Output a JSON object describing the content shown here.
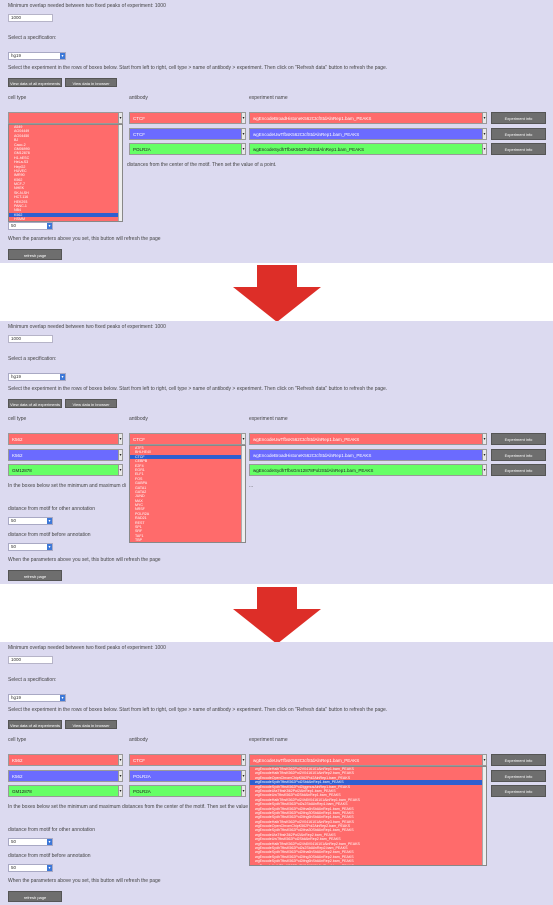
{
  "header_text": "Minimum overlap needed between two fixed peaks of experiment: 1000",
  "overlap_value": "1000",
  "genome_label": "Select a specification:",
  "genome_value": "hg19",
  "instructions": "Select the experiment in the rows of boxes below. Start from left to right, cell type > name of antibody > experiment. Then click on \"Refresh data\" button to refresh the page.",
  "buttons": {
    "view_all": "View data of all experiments",
    "view_table": "View data in browser",
    "experiment_btn": "Experiment info",
    "refresh": "refresh page"
  },
  "col_labels": {
    "cell": "cell type",
    "antibody": "antibody",
    "experiment": "experiment name"
  },
  "note_text": "In the boxes below set the minimum and maximum distances from the center of the motif. Then set the value of a point.",
  "note_text_short": "distances from the center of the motif. Then set the value of a point.",
  "min_label": "distance from motif for other annotation",
  "max_label": "distance from motif before annotation",
  "min_value": "50",
  "max_value": "50",
  "step_value": "50",
  "bottom_text": "When the parameters above you set, this button will refresh the page",
  "colors": {
    "panel_bg": "#dcdaf0",
    "row1": "#ff6b6b",
    "row2": "#6b6bff",
    "row3": "#66ff66",
    "arrow": "#dd2e28",
    "highlight": "#2f5fd0"
  },
  "panel1": {
    "rows": [
      {
        "cell": "",
        "antibody": "CTCF",
        "experiment": "wgEncodeBroadHistoneK562CtcfStdAlnRep1.bam_PEAKS"
      },
      {
        "cell": "",
        "antibody": "CTCF",
        "experiment": "wgEncodeUwTfbsK562CtcfStdAlnRep1.bam_PEAKS"
      },
      {
        "cell": "",
        "antibody": "POLR2A",
        "experiment": "wgEncodeSydhTfbsK562Pol2StdAlnRep1.bam_PEAKS"
      }
    ],
    "cell_list": [
      "A549",
      "AG04449",
      "AG04450",
      "BJ",
      "Caco-2",
      "GM06990",
      "GM12878",
      "H1-hESC",
      "HeLa-S3",
      "HepG2",
      "HUVEC",
      "IMR90",
      "K562",
      "MCF-7",
      "NHEK",
      "SK-N-SH",
      "HCT-116",
      "HEK293",
      "PANC-1",
      "NB4",
      "K562",
      "HSMM",
      "HMEC",
      "NHLF",
      "Osteobl"
    ],
    "cell_list_hl": 20
  },
  "panel2": {
    "rows": [
      {
        "cell": "K562",
        "antibody": "CTCF",
        "experiment": "wgEncodeUwTfbsK562CtcfStdAlnRep1.bam_PEAKS"
      },
      {
        "cell": "K562",
        "antibody": "",
        "experiment": "wgEncodeBroadHistoneK562CtcfStdAlnRep1.bam_PEAKS"
      },
      {
        "cell": "GM12878",
        "antibody": "",
        "experiment": "wgEncodeSydhTfbsGm12878Pol2StdAlnRep1.bam_PEAKS"
      }
    ],
    "antibody_list": [
      "ATF3",
      "BHLHE40",
      "CTCF",
      "CEBPB",
      "E2F4",
      "EGR1",
      "ELF1",
      "FOS",
      "GABPA",
      "GATA1",
      "GATA2",
      "JUND",
      "MAX",
      "MYC",
      "NRSF",
      "POLR2A",
      "RAD21",
      "REST",
      "SP1",
      "SRF",
      "TAF1",
      "TBP",
      "USF1",
      "YY1",
      "ZNF263"
    ],
    "antibody_list_hl": 2
  },
  "panel3": {
    "rows": [
      {
        "cell": "K562",
        "antibody": "CTCF",
        "experiment": "wgEncodeUwTfbsK562CtcfStdAlnRep1.bam_PEAKS"
      },
      {
        "cell": "K562",
        "antibody": "POLR2A",
        "experiment": ""
      },
      {
        "cell": "GM12878",
        "antibody": "POLR2A",
        "experiment": ""
      }
    ],
    "experiment_list": [
      "wgEncodeHaibTfbsK562Pol2V0416101AlnRep1.bam_PEAKS",
      "wgEncodeHaibTfbsK562Pol2V0416101AlnRep2.bam_PEAKS",
      "wgEncodeOpenChromChipK562Pol2AlnRep1.bam_PEAKS",
      "wgEncodeSydhTfbsK562Pol2StdAlnRep1.bam_PEAKS",
      "wgEncodeSydhTfbsK562Pol2IggmusAlnRep1.bam_PEAKS",
      "wgEncodeUtaTfbsK562Pol2AlnRep1.bam_PEAKS",
      "wgEncodeUwTfbsK562Pol2StdAlnRep1.bam_PEAKS",
      "wgEncodeHaibTfbsK562Pol24h8V0416101AlnRep1.bam_PEAKS",
      "wgEncodeSydhTfbsK562Pol2s2StdAlnRep1.bam_PEAKS",
      "wgEncodeSydhTfbsK562Pol2Ifna6hStdAlnRep1.bam_PEAKS",
      "wgEncodeSydhTfbsK562Pol2Ifng30StdAlnRep1.bam_PEAKS",
      "wgEncodeSydhTfbsK562Pol2Ifng6hStdAlnRep1.bam_PEAKS",
      "wgEncodeHaibTfbsK562Pol2V0416101AlnRep3.bam_PEAKS",
      "wgEncodeOpenChromChipK562Pol2AlnRep2.bam_PEAKS",
      "wgEncodeSydhTfbsK562Pol2Ifna30StdAlnRep1.bam_PEAKS",
      "wgEncodeUtaTfbsK562Pol2AlnRep2.bam_PEAKS",
      "wgEncodeUwTfbsK562Pol2StdAlnRep2.bam_PEAKS",
      "wgEncodeHaibTfbsK562Pol24h8V0416101AlnRep2.bam_PEAKS",
      "wgEncodeSydhTfbsK562Pol2s2StdAlnRep2.bam_PEAKS",
      "wgEncodeSydhTfbsK562Pol2Ifna6hStdAlnRep2.bam_PEAKS",
      "wgEncodeSydhTfbsK562Pol2Ifng30StdAlnRep2.bam_PEAKS",
      "wgEncodeSydhTfbsK562Pol2Ifng6hStdAlnRep2.bam_PEAKS",
      "wgEncodeHaibTfbsK562Pol2V0416101AlnRep4.bam_PEAKS"
    ],
    "experiment_list_hl": 3
  }
}
